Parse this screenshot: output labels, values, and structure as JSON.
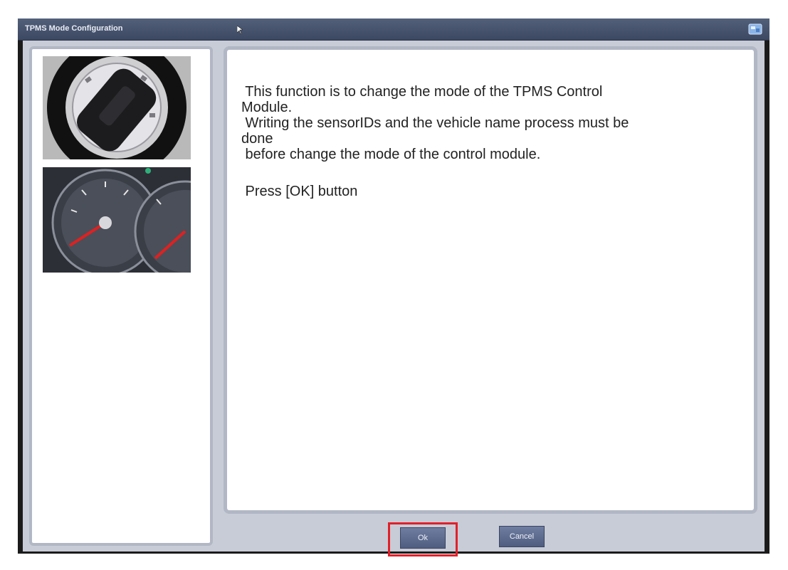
{
  "window": {
    "title": "TPMS Mode Configuration"
  },
  "message": {
    "lines": [
      " This function is to change the mode of the TPMS Control",
      "Module.",
      " Writing the sensorIDs and the vehicle name process must be",
      "done",
      " before change the mode of the control module."
    ],
    "instruction": " Press [OK] button"
  },
  "buttons": {
    "ok_label": "Ok",
    "cancel_label": "Cancel"
  },
  "icons": {
    "title_icon": "window-icon",
    "ignition_image": "ignition-switch-image",
    "cluster_image": "instrument-cluster-image"
  },
  "colors": {
    "titlebar": "#3c4862",
    "button": "#5a6788",
    "highlight": "#e0202a"
  }
}
